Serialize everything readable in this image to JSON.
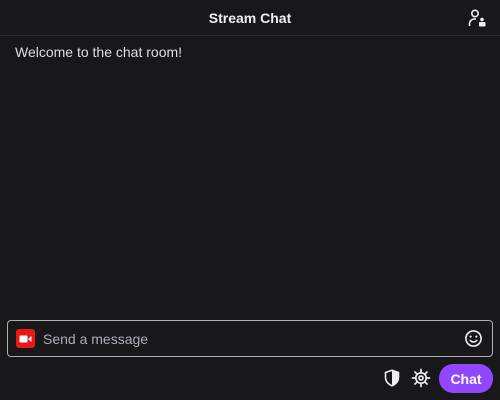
{
  "header": {
    "title": "Stream Chat",
    "users_icon": "community-users-icon"
  },
  "chat": {
    "messages": [
      {
        "text": "Welcome to the chat room!"
      }
    ]
  },
  "input": {
    "placeholder": "Send a message",
    "value": "",
    "camera_icon": "camera-icon",
    "emoji_icon": "emoji-smile-icon"
  },
  "footer": {
    "shield_icon": "shield-icon",
    "settings_icon": "gear-icon",
    "chat_button_label": "Chat"
  },
  "colors": {
    "background": "#18181b",
    "accent": "#9147ff",
    "camera_red": "#e91916",
    "input_border": "#adadb8",
    "text": "#efeff1"
  }
}
